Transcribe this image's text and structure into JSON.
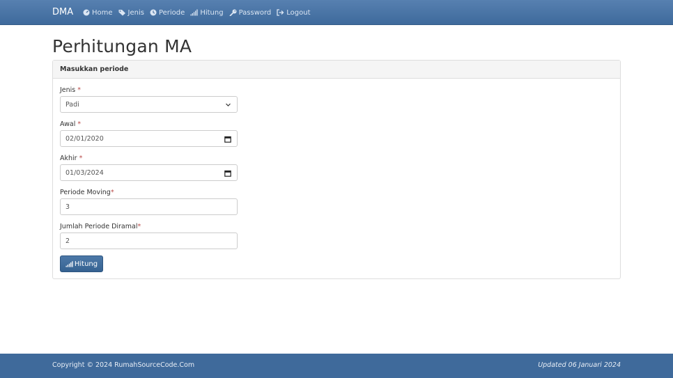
{
  "navbar": {
    "brand": "DMA",
    "items": [
      {
        "label": "Home",
        "icon": "dashboard-icon"
      },
      {
        "label": "Jenis",
        "icon": "tags-icon"
      },
      {
        "label": "Periode",
        "icon": "clock-icon"
      },
      {
        "label": "Hitung",
        "icon": "signal-icon"
      },
      {
        "label": "Password",
        "icon": "key-icon"
      },
      {
        "label": "Logout",
        "icon": "sign-out-icon"
      }
    ]
  },
  "page": {
    "title": "Perhitungan MA"
  },
  "panel": {
    "heading": "Masukkan periode",
    "fields": {
      "jenis": {
        "label": "Jenis ",
        "required": "*",
        "value": "Padi"
      },
      "awal": {
        "label": "Awal ",
        "required": "*",
        "value": "02/01/2020"
      },
      "akhir": {
        "label": "Akhir ",
        "required": "*",
        "value": "01/03/2024"
      },
      "periode_moving": {
        "label": "Periode Moving",
        "required": "*",
        "value": "3"
      },
      "jumlah_periode": {
        "label": "Jumlah Periode Diramal",
        "required": "*",
        "value": "2"
      }
    },
    "submit_label": "Hitung"
  },
  "footer": {
    "copyright": "Copyright © 2024 RumahSourceCode.Com",
    "updated": "Updated 06 Januari 2024"
  },
  "colors": {
    "navbar": "#3e6a9c",
    "footer": "#3f6a9b",
    "required": "#b94a48",
    "button": "#356291"
  }
}
